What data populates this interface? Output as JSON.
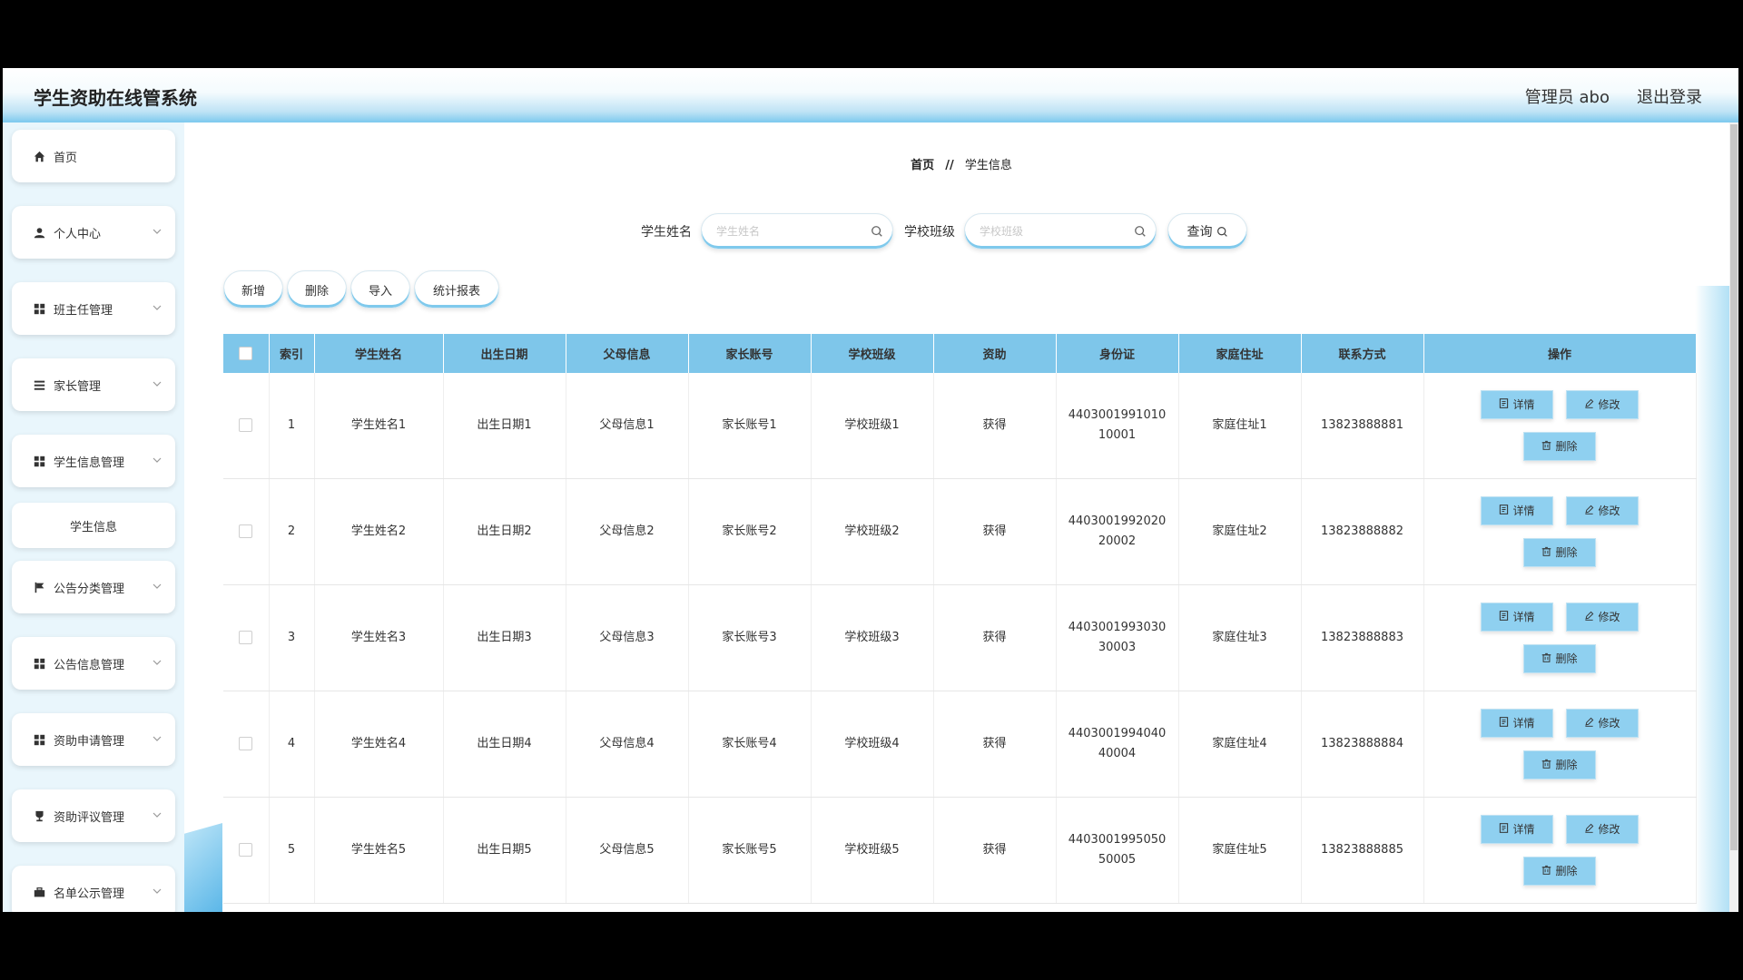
{
  "header": {
    "app_title": "学生资助在线管系统",
    "admin_label": "管理员 abo",
    "logout_label": "退出登录"
  },
  "sidebar": {
    "items": [
      {
        "label": "首页",
        "icon": "home-icon",
        "has_chevron": false
      },
      {
        "label": "个人中心",
        "icon": "user-icon",
        "has_chevron": true
      },
      {
        "label": "班主任管理",
        "icon": "grid-icon",
        "has_chevron": true
      },
      {
        "label": "家长管理",
        "icon": "list-icon",
        "has_chevron": true
      },
      {
        "label": "学生信息管理",
        "icon": "grid-icon",
        "has_chevron": true
      },
      {
        "label": "学生信息",
        "icon": "",
        "has_chevron": false,
        "submenu": true
      },
      {
        "label": "公告分类管理",
        "icon": "flag-icon",
        "has_chevron": true
      },
      {
        "label": "公告信息管理",
        "icon": "grid-icon",
        "has_chevron": true
      },
      {
        "label": "资助申请管理",
        "icon": "grid-icon",
        "has_chevron": true
      },
      {
        "label": "资助评议管理",
        "icon": "trophy-icon",
        "has_chevron": true
      },
      {
        "label": "名单公示管理",
        "icon": "briefcase-icon",
        "has_chevron": true
      }
    ]
  },
  "breadcrumb": {
    "home": "首页",
    "separator": "//",
    "current": "学生信息"
  },
  "search": {
    "name_label": "学生姓名",
    "name_placeholder": "学生姓名",
    "class_label": "学校班级",
    "class_placeholder": "学校班级",
    "query_label": "查询"
  },
  "actions": {
    "add": "新增",
    "delete": "删除",
    "import": "导入",
    "report": "统计报表"
  },
  "table": {
    "columns": [
      "索引",
      "学生姓名",
      "出生日期",
      "父母信息",
      "家长账号",
      "学校班级",
      "资助",
      "身份证",
      "家庭住址",
      "联系方式",
      "操作"
    ],
    "op_labels": {
      "detail": "详情",
      "edit": "修改",
      "delete": "删除"
    },
    "rows": [
      {
        "index": "1",
        "name": "学生姓名1",
        "birth": "出生日期1",
        "parents": "父母信息1",
        "parent_account": "家长账号1",
        "class": "学校班级1",
        "aid": "获得",
        "id_card_line1": "4403001991010",
        "id_card_line2": "10001",
        "address": "家庭住址1",
        "phone": "13823888881"
      },
      {
        "index": "2",
        "name": "学生姓名2",
        "birth": "出生日期2",
        "parents": "父母信息2",
        "parent_account": "家长账号2",
        "class": "学校班级2",
        "aid": "获得",
        "id_card_line1": "4403001992020",
        "id_card_line2": "20002",
        "address": "家庭住址2",
        "phone": "13823888882"
      },
      {
        "index": "3",
        "name": "学生姓名3",
        "birth": "出生日期3",
        "parents": "父母信息3",
        "parent_account": "家长账号3",
        "class": "学校班级3",
        "aid": "获得",
        "id_card_line1": "4403001993030",
        "id_card_line2": "30003",
        "address": "家庭住址3",
        "phone": "13823888883"
      },
      {
        "index": "4",
        "name": "学生姓名4",
        "birth": "出生日期4",
        "parents": "父母信息4",
        "parent_account": "家长账号4",
        "class": "学校班级4",
        "aid": "获得",
        "id_card_line1": "4403001994040",
        "id_card_line2": "40004",
        "address": "家庭住址4",
        "phone": "13823888884"
      },
      {
        "index": "5",
        "name": "学生姓名5",
        "birth": "出生日期5",
        "parents": "父母信息5",
        "parent_account": "家长账号5",
        "class": "学校班级5",
        "aid": "获得",
        "id_card_line1": "4403001995050",
        "id_card_line2": "50005",
        "address": "家庭住址5",
        "phone": "13823888885"
      }
    ]
  },
  "colors": {
    "header_accent": "#7cc9ee",
    "table_header": "#7ec6ea",
    "button_fill": "#8fd0f0",
    "sidebar_bg": "#e9f6fc"
  }
}
